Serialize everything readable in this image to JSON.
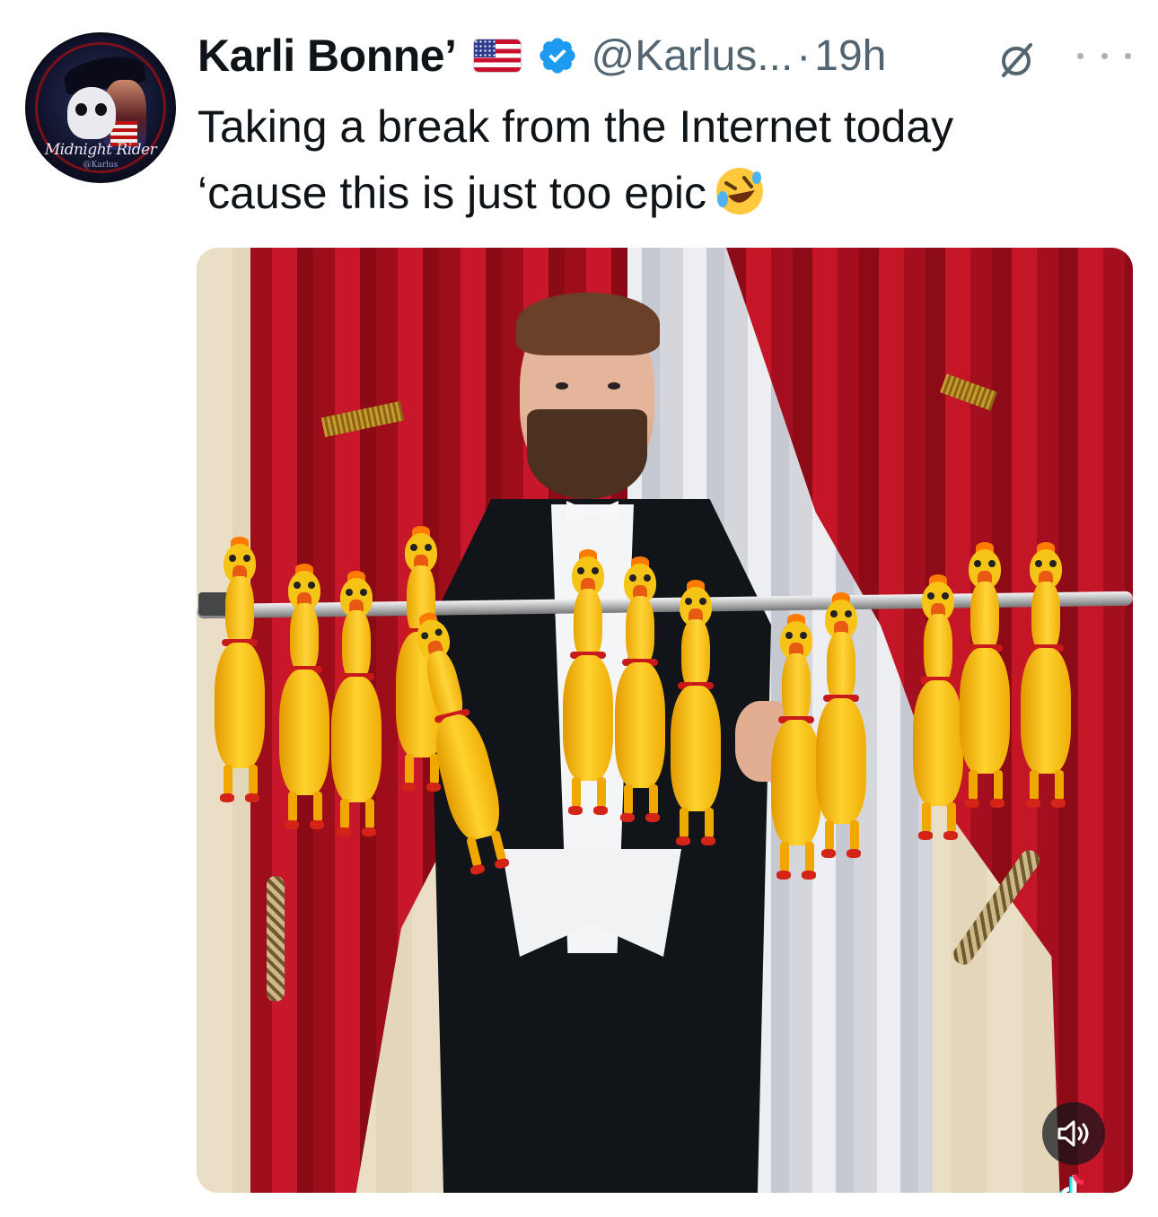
{
  "author": {
    "name": "Karli Bonne’",
    "handle": "@Karlus...",
    "separator": "·",
    "time": "19h",
    "avatar_text": "Midnight Rider",
    "avatar_subtext": "@Karlus"
  },
  "icons": {
    "flag": "us-flag-emoji",
    "verified": "verified-badge-icon",
    "mute": "grok-slash-circle-icon",
    "more": "more-icon",
    "tweet_emoji": "rolling-on-floor-laughing-emoji",
    "video_mute": "speaker-icon",
    "watermark": "tiktok-icon"
  },
  "tweet": {
    "line1": "Taking a break from the Internet today",
    "line2": "‘cause this is just too epic"
  },
  "colors": {
    "text": "#0f1419",
    "secondary": "#536471",
    "verified": "#1d9bf0",
    "curtain": "#c8172a",
    "chicken": "#ffd22e"
  }
}
